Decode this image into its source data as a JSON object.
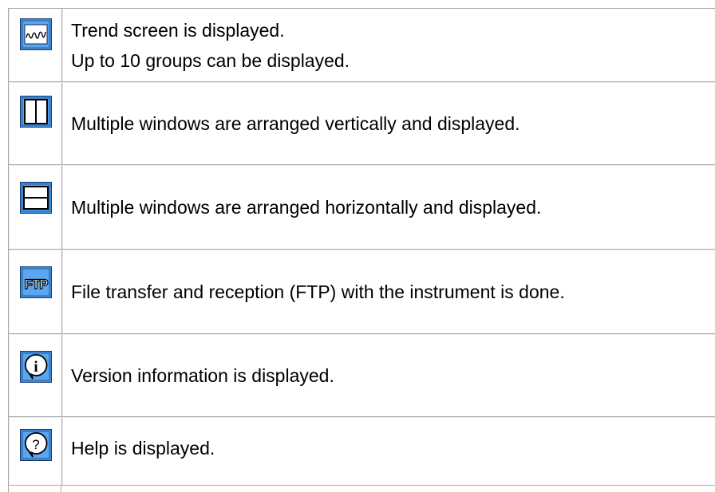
{
  "rows": [
    {
      "icon": "trend-icon",
      "lines": [
        "Trend screen is displayed.",
        "Up to 10 groups can be displayed."
      ]
    },
    {
      "icon": "vertical-split-icon",
      "lines": [
        "Multiple windows are arranged vertically and displayed."
      ]
    },
    {
      "icon": "horizontal-split-icon",
      "lines": [
        "Multiple windows are arranged horizontally and displayed."
      ]
    },
    {
      "icon": "ftp-icon",
      "icon_text": "FTP",
      "lines": [
        "File transfer and reception (FTP) with the instrument is done."
      ]
    },
    {
      "icon": "info-icon",
      "icon_text": "i",
      "lines": [
        "Version information is displayed."
      ]
    },
    {
      "icon": "help-icon",
      "icon_text": "?",
      "lines": [
        "Help is displayed."
      ]
    }
  ],
  "colors": {
    "icon_blue": "#3f8fe0",
    "icon_border": "#1a3a6a",
    "grid_dark": "#a8a8a8",
    "grid_light": "#ececec"
  }
}
